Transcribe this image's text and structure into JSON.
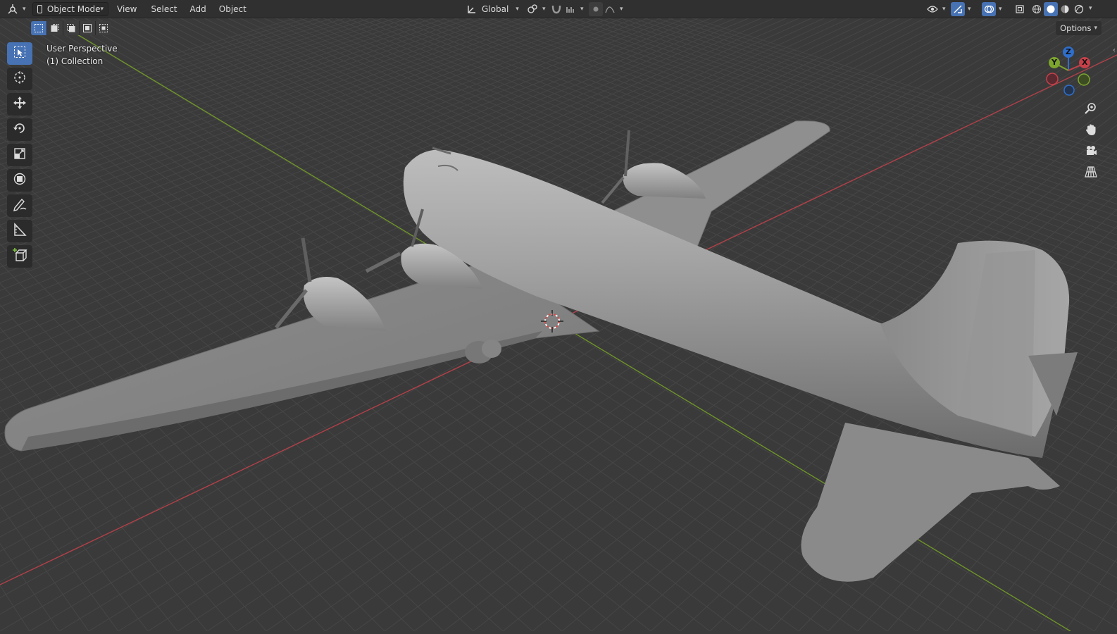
{
  "header": {
    "editor_type_icon": "viewport-editor-icon",
    "mode_label": "Object Mode",
    "menus": [
      "View",
      "Select",
      "Add",
      "Object"
    ],
    "orientation_label": "Global",
    "pivot_icon": "pivot-icon",
    "snap_icon": "snap-magnet-icon",
    "proportional_icon": "proportional-edit-icon"
  },
  "selection_modes": [
    "set-selection-icon",
    "extend-selection-icon",
    "subtract-selection-icon",
    "invert-selection-icon",
    "intersect-selection-icon"
  ],
  "options_label": "Options",
  "overlay": {
    "view_name": "User Perspective",
    "collection": "(1) Collection"
  },
  "tools": [
    {
      "name": "select-box-tool",
      "icon": "select-box-icon",
      "active": true
    },
    {
      "name": "cursor-tool",
      "icon": "cursor-icon",
      "active": false
    },
    {
      "name": "move-tool",
      "icon": "move-icon",
      "active": false
    },
    {
      "name": "rotate-tool",
      "icon": "rotate-icon",
      "active": false
    },
    {
      "name": "scale-tool",
      "icon": "scale-icon",
      "active": false
    },
    {
      "name": "transform-tool",
      "icon": "transform-icon",
      "active": false
    },
    {
      "name": "annotate-tool",
      "icon": "annotate-icon",
      "active": false
    },
    {
      "name": "measure-tool",
      "icon": "measure-icon",
      "active": false
    },
    {
      "name": "add-cube-tool",
      "icon": "add-cube-icon",
      "active": false
    }
  ],
  "gizmo": {
    "x_label": "X",
    "y_label": "Y",
    "z_label": "Z"
  },
  "colors": {
    "accent": "#4772b3",
    "grid_bg": "#3a3a3a",
    "x_axis": "#c6404a",
    "y_axis": "#7ea42d",
    "z_axis": "#2f6fcc",
    "mesh": "#9a9a9a"
  }
}
